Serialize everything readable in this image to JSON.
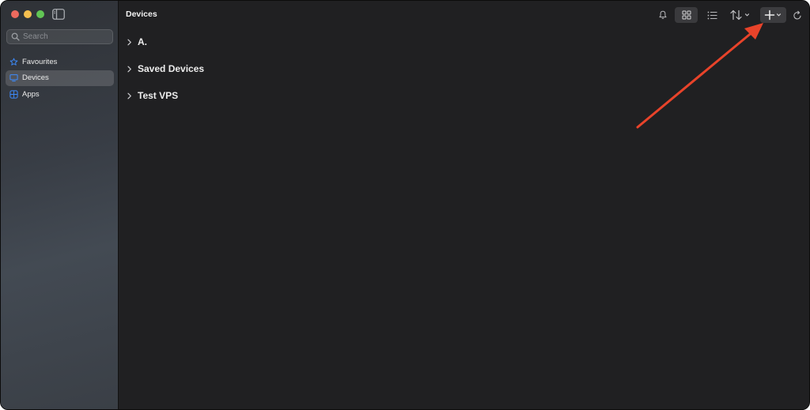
{
  "sidebar": {
    "search_placeholder": "Search",
    "items": [
      {
        "label": "Favourites",
        "icon": "star-icon",
        "active": false
      },
      {
        "label": "Devices",
        "icon": "monitor-icon",
        "active": true
      },
      {
        "label": "Apps",
        "icon": "apps-grid-icon",
        "active": false
      }
    ]
  },
  "main": {
    "title": "Devices",
    "groups": [
      {
        "label": "A.",
        "icon": "chevron-right-icon"
      },
      {
        "label": "Saved Devices",
        "icon": "chevron-right-icon"
      },
      {
        "label": "Test VPS",
        "icon": "chevron-right-icon"
      }
    ]
  },
  "toolbar": {
    "icons": [
      "bell-icon",
      "grid-view-icon",
      "list-view-icon",
      "sort-icon",
      "add-icon",
      "refresh-icon"
    ],
    "active_view": "grid"
  },
  "colors": {
    "accent_blue": "#3d8bfd",
    "annotation_arrow": "#e8432a",
    "traffic_red": "#ed6a5e",
    "traffic_yellow": "#f5bf4f",
    "traffic_green": "#61c554"
  }
}
